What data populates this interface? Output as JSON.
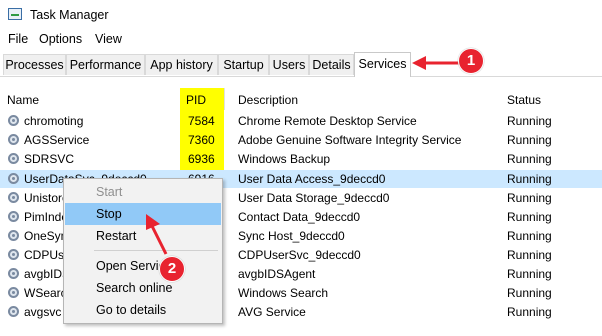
{
  "window": {
    "title": "Task Manager"
  },
  "menu": [
    "File",
    "Options",
    "View"
  ],
  "tabs": [
    "Processes",
    "Performance",
    "App history",
    "Startup",
    "Users",
    "Details",
    "Services"
  ],
  "active_tab": "Services",
  "columns": {
    "name": "Name",
    "pid": "PID",
    "description": "Description",
    "status": "Status"
  },
  "rows": [
    {
      "name": "chromoting",
      "pid": "7584",
      "description": "Chrome Remote Desktop Service",
      "status": "Running"
    },
    {
      "name": "AGSService",
      "pid": "7360",
      "description": "Adobe Genuine Software Integrity Service",
      "status": "Running"
    },
    {
      "name": "SDRSVC",
      "pid": "6936",
      "description": "Windows Backup",
      "status": "Running"
    },
    {
      "name": "UserDataSvc_9deccd0",
      "pid": "6916",
      "description": "User Data Access_9deccd0",
      "status": "Running"
    },
    {
      "name": "UnistoreSvc_9deccd0",
      "pid": "",
      "description": "User Data Storage_9deccd0",
      "status": "Running"
    },
    {
      "name": "PimIndexMaintenanceSvc_9deccd0",
      "pid": "",
      "description": "Contact Data_9deccd0",
      "status": "Running"
    },
    {
      "name": "OneSyncSvc_9deccd0",
      "pid": "",
      "description": "Sync Host_9deccd0",
      "status": "Running"
    },
    {
      "name": "CDPUserSvc_9deccd0",
      "pid": "",
      "description": "CDPUserSvc_9deccd0",
      "status": "Running"
    },
    {
      "name": "avgbIDSAgent",
      "pid": "",
      "description": "avgbIDSAgent",
      "status": "Running"
    },
    {
      "name": "WSearch",
      "pid": "",
      "description": "Windows Search",
      "status": "Running"
    },
    {
      "name": "avgsvc",
      "pid": "",
      "description": "AVG Service",
      "status": "Running"
    }
  ],
  "context_menu": [
    "Start",
    "Stop",
    "Restart",
    "Open Services",
    "Search online",
    "Go to details"
  ],
  "annotations": {
    "step1": "1",
    "step2": "2"
  },
  "colors": {
    "highlight": "#ffff00",
    "selected_row": "#cce8ff",
    "badge": "#e8232f"
  }
}
